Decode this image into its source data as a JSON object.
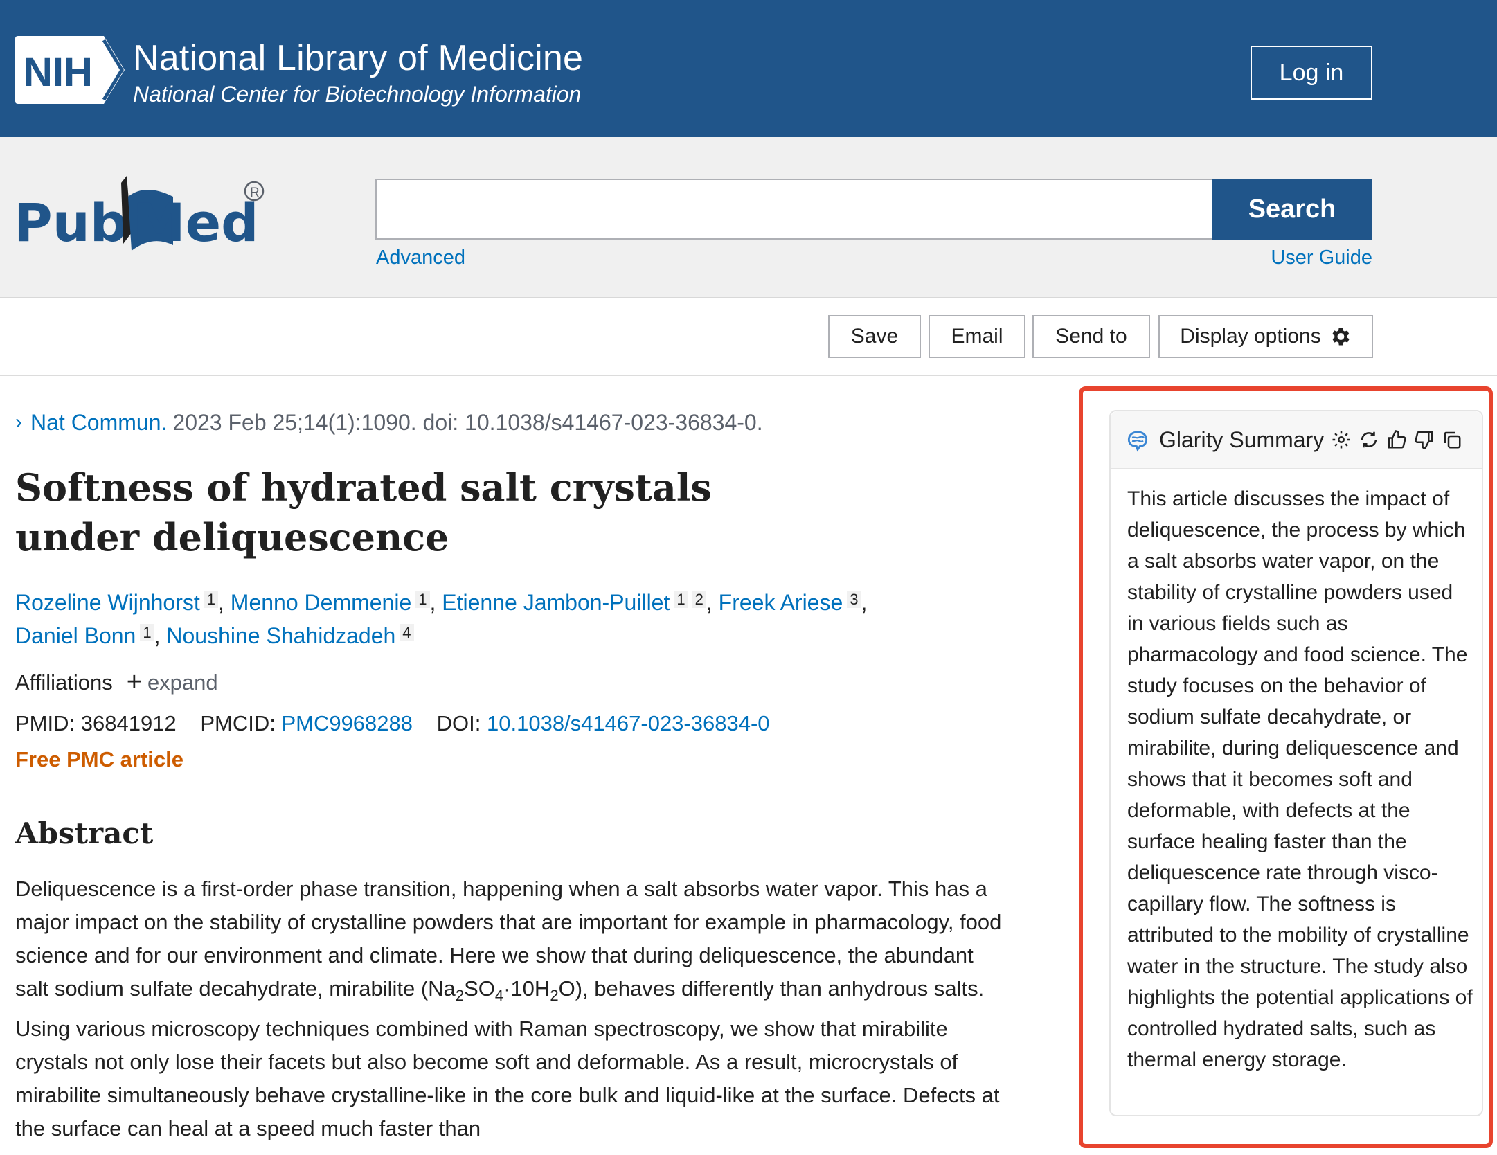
{
  "nih": {
    "badge": "NIH",
    "title": "National Library of Medicine",
    "subtitle": "National Center for Biotechnology Information",
    "login": "Log in"
  },
  "search": {
    "logo_text": "PubMed",
    "value": "",
    "button": "Search",
    "advanced": "Advanced",
    "user_guide": "User Guide"
  },
  "actions": {
    "save": "Save",
    "email": "Email",
    "send_to": "Send to",
    "display_options": "Display options"
  },
  "article": {
    "journal": "Nat Commun.",
    "citation": "2023 Feb 25;14(1):1090. doi: 10.1038/s41467-023-36834-0.",
    "title": "Softness of hydrated salt crystals under deliquescence",
    "authors": [
      {
        "name": "Rozeline Wijnhorst",
        "aff": [
          "1"
        ]
      },
      {
        "name": "Menno Demmenie",
        "aff": [
          "1"
        ]
      },
      {
        "name": "Etienne Jambon-Puillet",
        "aff": [
          "1",
          "2"
        ]
      },
      {
        "name": "Freek Ariese",
        "aff": [
          "3"
        ]
      },
      {
        "name": "Daniel Bonn",
        "aff": [
          "1"
        ]
      },
      {
        "name": "Noushine Shahidzadeh",
        "aff": [
          "4"
        ]
      }
    ],
    "affiliations_label": "Affiliations",
    "expand_label": "expand",
    "pmid_label": "PMID:",
    "pmid": "36841912",
    "pmcid_label": "PMCID:",
    "pmcid": "PMC9968288",
    "doi_label": "DOI:",
    "doi": "10.1038/s41467-023-36834-0",
    "free_label": "Free PMC article",
    "abstract_heading": "Abstract",
    "abstract_p1": "Deliquescence is a first-order phase transition, happening when a salt absorbs water vapor. This has a major impact on the stability of crystalline powders that are important for example in pharmacology, food science and for our environment and climate. Here we show that during deliquescence, the abundant salt sodium sulfate decahydrate, mirabilite (",
    "formula": [
      "Na",
      "2",
      "SO",
      "4",
      "·10H",
      "2",
      "O"
    ],
    "abstract_p2": "), behaves differently than anhydrous salts. Using various microscopy techniques combined with Raman spectroscopy, we show that mirabilite crystals not only lose their facets but also become soft and deformable. As a result, microcrystals of mirabilite simultaneously behave crystalline-like in the core bulk and liquid-like at the surface. Defects at the surface can heal at a speed much faster than"
  },
  "glarity": {
    "title": "Glarity Summary",
    "summary": "This article discusses the impact of deliquescence, the process by which a salt absorbs water vapor, on the stability of crystalline powders used in various fields such as pharmacology and food science. The study focuses on the behavior of sodium sulfate decahydrate, or mirabilite, during deliquescence and shows that it becomes soft and deformable, with defects at the surface healing faster than the deliquescence rate through visco-capillary flow. The softness is attributed to the mobility of crystalline water in the structure. The study also highlights the potential applications of controlled hydrated salts, such as thermal energy storage.",
    "icons": [
      "settings-icon",
      "refresh-icon",
      "thumbs-up-icon",
      "thumbs-down-icon",
      "copy-icon"
    ],
    "highlight_color": "#e8442e"
  },
  "colors": {
    "nih_blue": "#20558a",
    "link": "#0071bc",
    "free_orange": "#cd5c00"
  }
}
